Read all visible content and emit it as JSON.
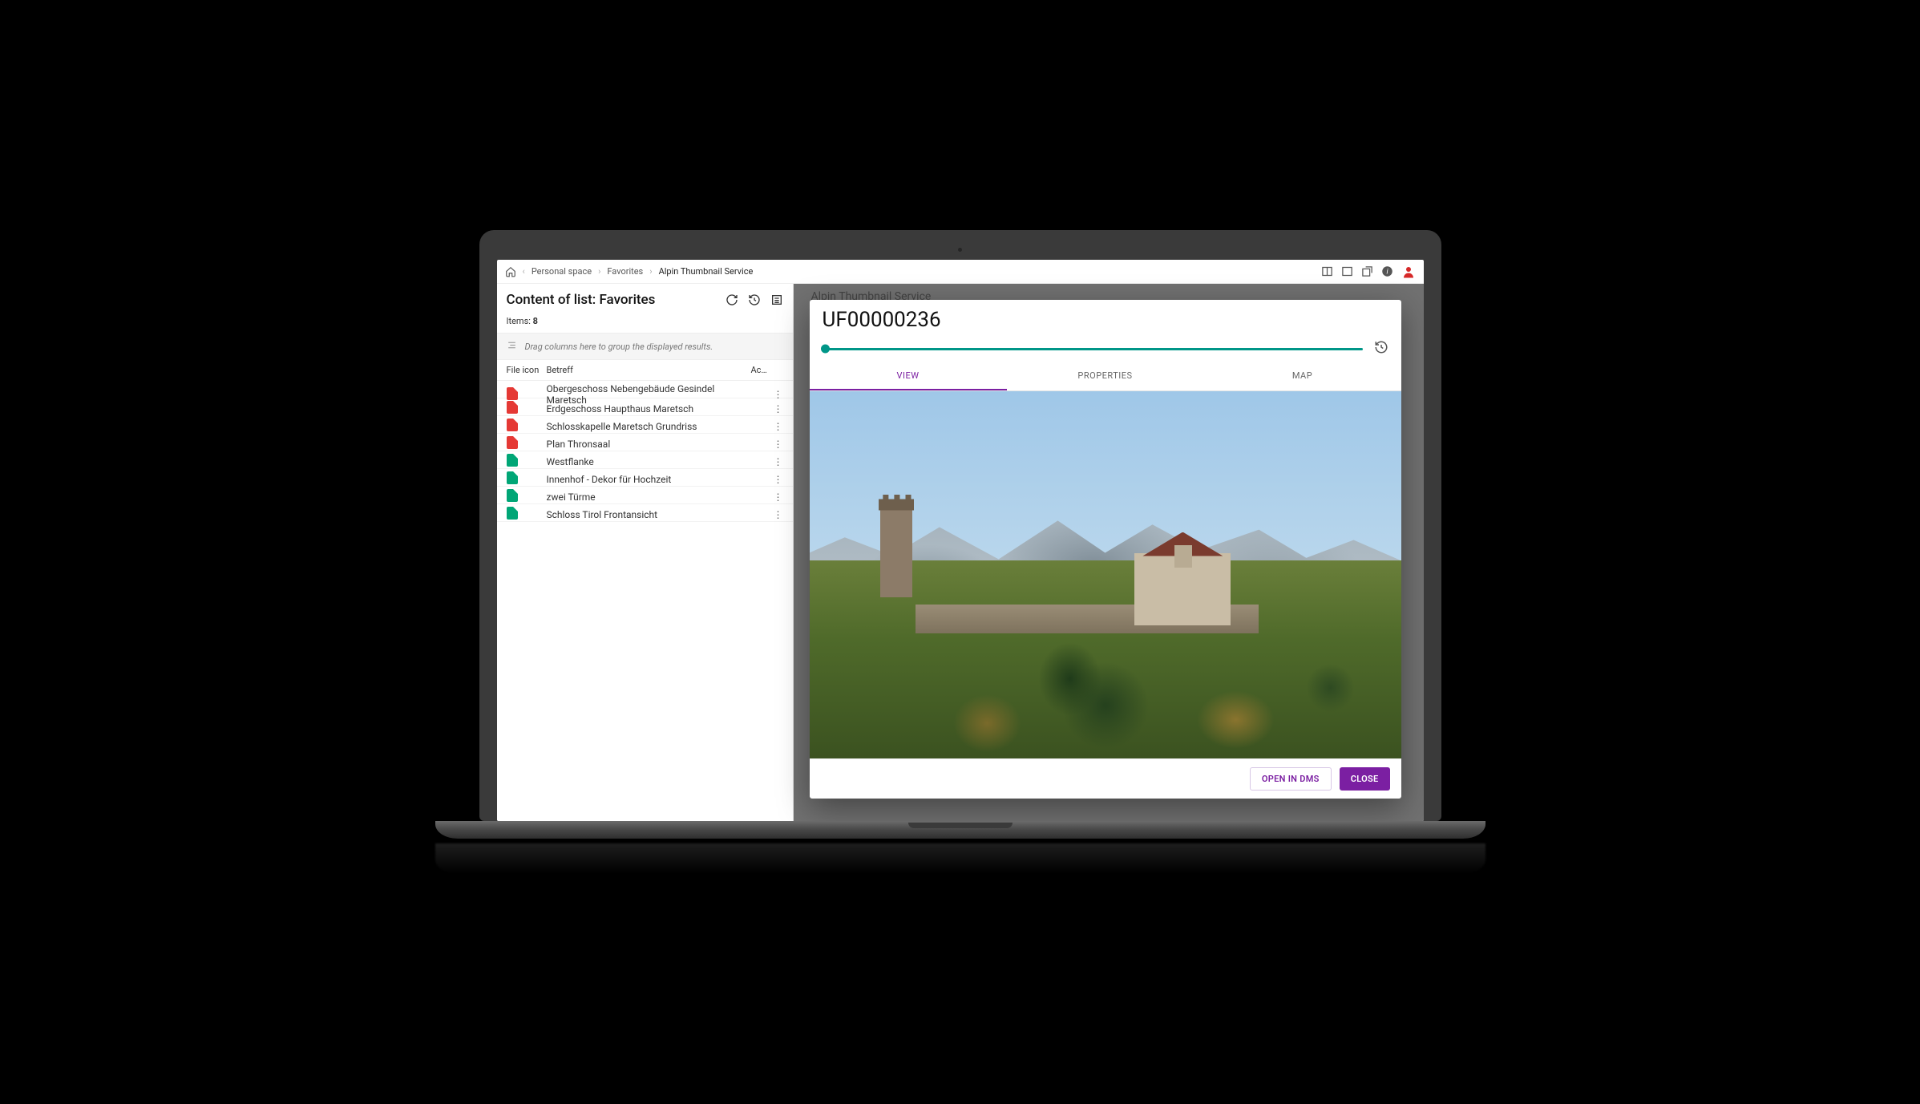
{
  "breadcrumbs": {
    "items": [
      "Personal space",
      "Favorites",
      "Alpin Thumbnail Service"
    ],
    "sep": "›"
  },
  "sidebar": {
    "title": "Content of list: Favorites",
    "items_label": "Items:",
    "items_count": "8",
    "group_hint": "Drag columns here to group the displayed results.",
    "columns": {
      "icon": "File icon",
      "subject": "Betreff",
      "actions": "Ac…"
    },
    "rows": [
      {
        "type": "pdf",
        "subject": "Obergeschoss Nebengebäude Gesindel Maretsch"
      },
      {
        "type": "pdf",
        "subject": "Erdgeschoss Haupthaus Maretsch"
      },
      {
        "type": "pdf",
        "subject": "Schlosskapelle Maretsch Grundriss"
      },
      {
        "type": "pdf",
        "subject": "Plan Thronsaal"
      },
      {
        "type": "img",
        "subject": "Westflanke"
      },
      {
        "type": "img",
        "subject": "Innenhof - Dekor für Hochzeit"
      },
      {
        "type": "img",
        "subject": "zwei Türme"
      },
      {
        "type": "img",
        "subject": "Schloss Tirol Frontansicht"
      }
    ]
  },
  "main": {
    "service_title": "Alpin Thumbnail Service"
  },
  "modal": {
    "title": "UF00000236",
    "tabs": {
      "view": "VIEW",
      "properties": "PROPERTIES",
      "map": "MAP"
    },
    "buttons": {
      "open": "OPEN IN DMS",
      "close": "CLOSE"
    }
  },
  "colors": {
    "accent": "#7b1fa2",
    "teal": "#009688",
    "danger": "#d62828"
  }
}
